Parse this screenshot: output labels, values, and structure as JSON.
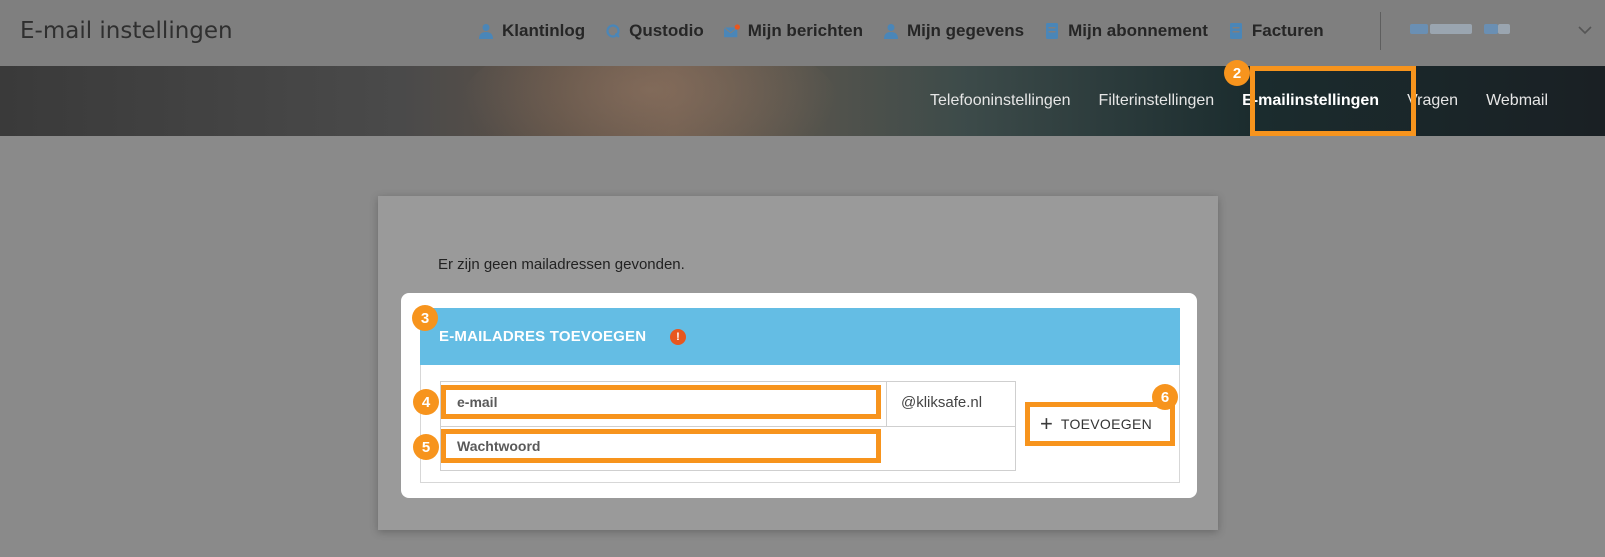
{
  "header": {
    "title": "E-mail instellingen",
    "nav": [
      {
        "label": "Klantinlog",
        "icon": "user-icon"
      },
      {
        "label": "Qustodio",
        "icon": "qustodio-icon"
      },
      {
        "label": "Mijn berichten",
        "icon": "envelope-icon"
      },
      {
        "label": "Mijn gegevens",
        "icon": "user-icon"
      },
      {
        "label": "Mijn abonnement",
        "icon": "document-icon"
      },
      {
        "label": "Facturen",
        "icon": "document-icon"
      }
    ]
  },
  "subnav": {
    "items": [
      "Telefooninstellingen",
      "Filterinstellingen",
      "E-mailinstellingen",
      "Vragen",
      "Webmail"
    ],
    "active": "E-mailinstellingen"
  },
  "main": {
    "notice": "Er zijn geen mailadressen gevonden.",
    "form": {
      "title": "E-MAILADRES TOEVOEGEN",
      "warning_symbol": "!",
      "email_placeholder": "e-mail",
      "domain": "@kliksafe.nl",
      "password_placeholder": "Wachtwoord",
      "add_label": "TOEVOEGEN",
      "add_symbol": "+"
    }
  },
  "callouts": [
    "2",
    "3",
    "4",
    "5",
    "6"
  ],
  "colors": {
    "accent": "#f7941d",
    "form_header": "#64bde4",
    "warning": "#e8571f"
  }
}
